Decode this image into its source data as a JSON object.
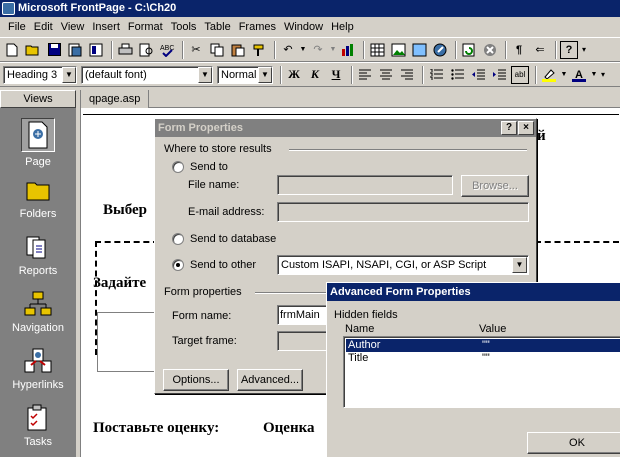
{
  "window": {
    "title": "Microsoft FrontPage - C:\\Ch20"
  },
  "menu": [
    "File",
    "Edit",
    "View",
    "Insert",
    "Format",
    "Tools",
    "Table",
    "Frames",
    "Window",
    "Help"
  ],
  "format_bar": {
    "style": "Heading 3",
    "font": "(default font)",
    "size": "Normal",
    "bold": "Ж",
    "italic": "К",
    "underline": "Ч"
  },
  "views": {
    "header": "Views",
    "items": [
      {
        "label": "Page",
        "icon": "page-icon"
      },
      {
        "label": "Folders",
        "icon": "folder-icon"
      },
      {
        "label": "Reports",
        "icon": "reports-icon"
      },
      {
        "label": "Navigation",
        "icon": "navigation-icon"
      },
      {
        "label": "Hyperlinks",
        "icon": "hyperlinks-icon"
      },
      {
        "label": "Tasks",
        "icon": "tasks-icon"
      }
    ]
  },
  "document": {
    "tab": "qpage.asp",
    "text_top_right": "й",
    "text_choose": "Выбер",
    "text_set": "Задайте",
    "text_rate": "Поставьте оценку:",
    "text_score": "Оценка"
  },
  "form_properties": {
    "title": "Form Properties",
    "help": "?",
    "close": "×",
    "group_store": "Where to store results",
    "send_to": "Send to",
    "file_name_label": "File name:",
    "browse": "Browse...",
    "email_label": "E-mail address:",
    "send_to_database": "Send to database",
    "send_to_other": "Send to other",
    "other_option": "Custom ISAPI, NSAPI, CGI, or ASP Script",
    "group_props": "Form properties",
    "form_name_label": "Form name:",
    "form_name_value": "frmMain",
    "target_frame_label": "Target frame:",
    "options_button": "Options...",
    "advanced_button": "Advanced..."
  },
  "advanced_form": {
    "title": "Advanced Form Properties",
    "hidden_fields_label": "Hidden fields",
    "col_name": "Name",
    "col_value": "Value",
    "rows": [
      {
        "name": "Author",
        "value": "\"\""
      },
      {
        "name": "Title",
        "value": "\"\""
      }
    ],
    "ok": "OK"
  },
  "colors": {
    "title_active": "#0a246a",
    "title_inactive": "#808080",
    "face": "#d4d0c8"
  }
}
